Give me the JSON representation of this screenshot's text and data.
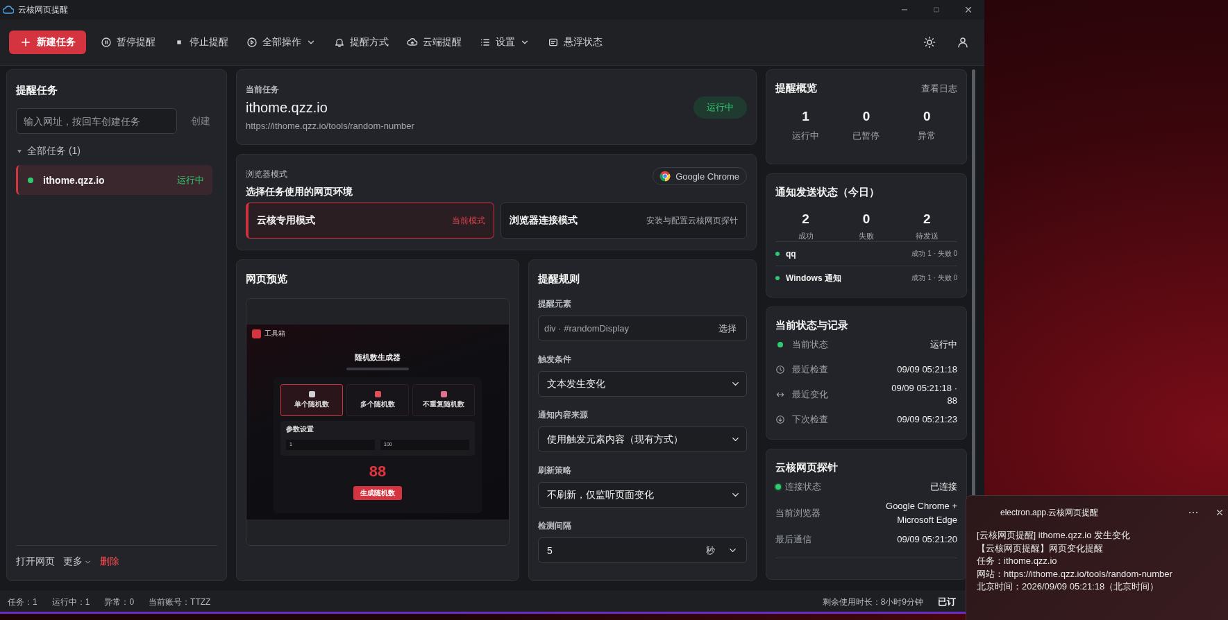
{
  "window": {
    "title": "云核网页提醒"
  },
  "toolbar": [
    {
      "kind": "primary",
      "label": "新建任务",
      "dropdown": false
    },
    {
      "kind": "item",
      "label": "暂停提醒",
      "dropdown": false
    },
    {
      "kind": "item",
      "label": "停止提醒",
      "dropdown": false
    },
    {
      "kind": "item",
      "label": "全部操作",
      "dropdown": true
    },
    {
      "kind": "item",
      "label": "提醒方式",
      "dropdown": false
    },
    {
      "kind": "item",
      "label": "云端提醒",
      "dropdown": false
    },
    {
      "kind": "item",
      "label": "设置",
      "dropdown": true
    },
    {
      "kind": "item",
      "label": "悬浮状态",
      "dropdown": false
    }
  ],
  "sidebar": {
    "title": "提醒任务",
    "input": {
      "placeholder": "输入网址，按回车创建任务"
    },
    "create_button": "创建",
    "group": {
      "label": "全部任务 (1)",
      "expanded": true,
      "children": [
        {
          "name": "ithome.qzz.io",
          "status": "运行中",
          "color": "#2ecc71",
          "selected": true
        }
      ]
    },
    "footer": [
      {
        "kind": "link",
        "label": "打开网页"
      },
      {
        "kind": "menu",
        "label": "更多"
      },
      {
        "kind": "danger",
        "label": "删除"
      }
    ]
  },
  "current_task": {
    "label": "当前任务",
    "name": "ithome.qzz.io",
    "url": "https://ithome.qzz.io/tools/random-number",
    "status": "运行中"
  },
  "browser_mode": {
    "label": "浏览器模式",
    "title": "选择任务使用的网页环境",
    "browser": "Google Chrome",
    "modes": [
      {
        "name": "云核专用模式",
        "note": "当前模式",
        "selected": true
      },
      {
        "name": "浏览器连接模式",
        "note": "安装与配置云核网页探针",
        "selected": false
      }
    ]
  },
  "preview": {
    "title": "网页预览",
    "page": {
      "brand": "工具箱",
      "heading": "随机数生成器",
      "modes": [
        {
          "label": "单个随机数",
          "selected": true
        },
        {
          "label": "多个随机数",
          "selected": false
        },
        {
          "label": "不重复随机数",
          "selected": false
        }
      ],
      "settings_title": "参数设置",
      "inputs": [
        "1",
        "100"
      ],
      "result": "88",
      "button": "生成随机数"
    }
  },
  "rules": {
    "title": "提醒规则",
    "fields": [
      {
        "kind": "picker",
        "label": "提醒元素",
        "value": "div · #randomDisplay",
        "action": "选择"
      },
      {
        "kind": "select",
        "label": "触发条件",
        "value": "文本发生变化"
      },
      {
        "kind": "select",
        "label": "通知内容来源",
        "value": "使用触发元素内容（现有方式）"
      },
      {
        "kind": "select",
        "label": "刷新策略",
        "value": "不刷新，仅监听页面变化"
      },
      {
        "kind": "number",
        "label": "检测间隔",
        "value": "5",
        "unit": "秒"
      }
    ]
  },
  "overview": {
    "title": "提醒概览",
    "link": "查看日志",
    "stats": [
      {
        "value": "1",
        "label": "运行中"
      },
      {
        "value": "0",
        "label": "已暂停"
      },
      {
        "value": "0",
        "label": "异常"
      }
    ]
  },
  "notify_status": {
    "title": "通知发送状态（今日）",
    "stats": [
      {
        "value": "2",
        "label": "成功"
      },
      {
        "value": "0",
        "label": "失败"
      },
      {
        "value": "2",
        "label": "待发送"
      }
    ],
    "channels": [
      {
        "name": "qq",
        "detail": "成功 1 · 失败 0",
        "color": "#2ecc71"
      },
      {
        "name": "Windows 通知",
        "detail": "成功 1 · 失败 0",
        "color": "#2ecc71"
      }
    ]
  },
  "records": {
    "title": "当前状态与记录",
    "rows": [
      {
        "kind": "status",
        "label": "当前状态",
        "value": "运行中"
      },
      {
        "kind": "clock",
        "label": "最近检查",
        "value": "09/09 05:21:18"
      },
      {
        "kind": "change",
        "label": "最近变化",
        "value": "09/09 05:21:18 · 88"
      },
      {
        "kind": "next",
        "label": "下次检查",
        "value": "09/09 05:21:23"
      }
    ]
  },
  "probe": {
    "title": "云核网页探针",
    "rows": [
      {
        "kind": "status",
        "label": "连接状态",
        "value": "已连接"
      },
      {
        "kind": "plain",
        "label": "当前浏览器",
        "value": "Google Chrome + Microsoft Edge"
      },
      {
        "kind": "plain",
        "label": "最后通信",
        "value": "09/09 05:21:20"
      }
    ]
  },
  "status_bar": {
    "items": [
      "任务：1",
      "运行中：1",
      "异常：0",
      "当前账号：TTZZ"
    ],
    "remaining": "剩余使用时长：8小时9分钟",
    "subscription": "已订"
  },
  "toast": {
    "app": "electron.app.云核网页提醒",
    "lines": [
      "[云核网页提醒] ithome.qzz.io 发生变化",
      "【云核网页提醒】网页变化提醒",
      "任务：ithome.qzz.io",
      "网站：https://ithome.qzz.io/tools/random-number",
      "北京时间：2026/09/09 05:21:18（北京时间）"
    ]
  }
}
